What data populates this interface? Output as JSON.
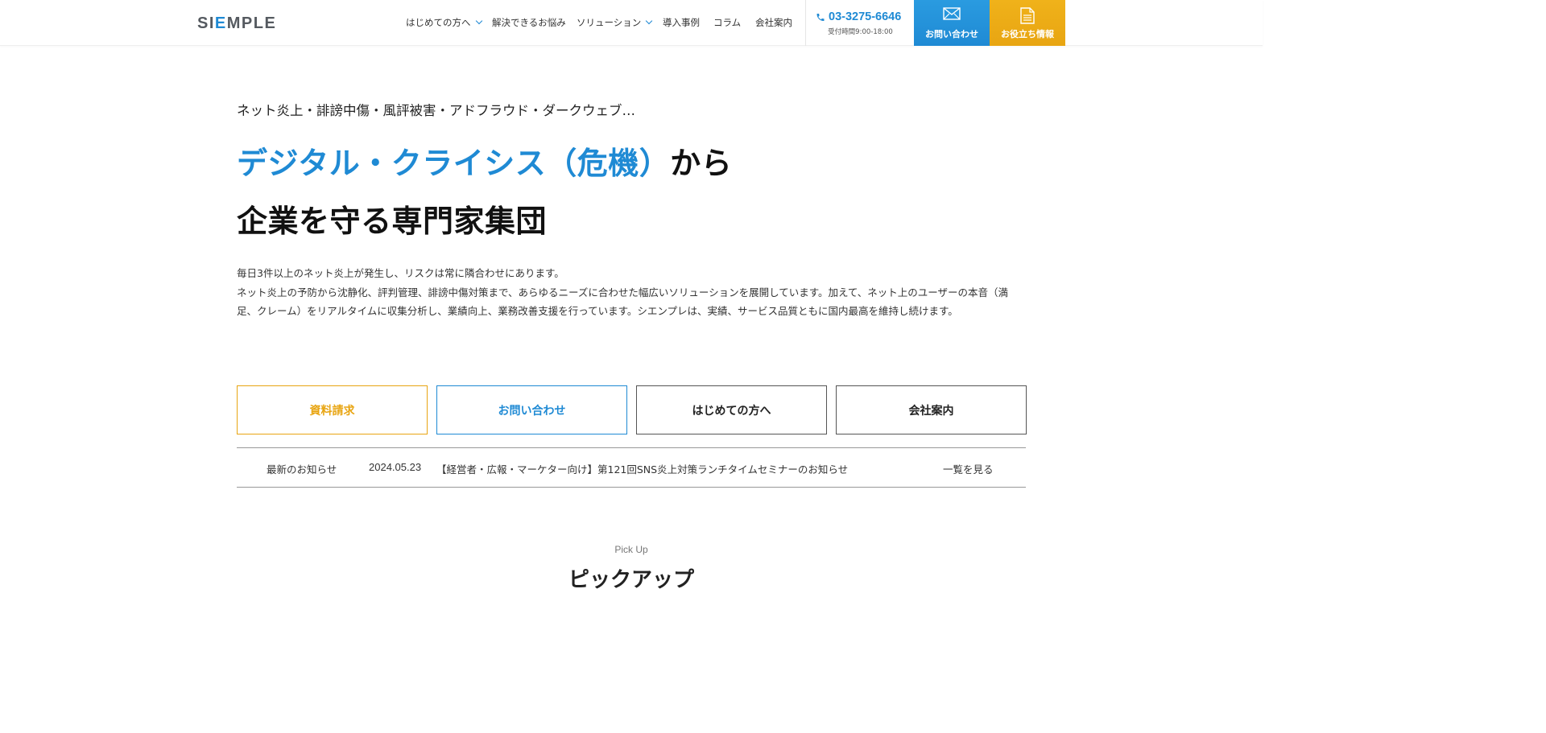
{
  "header": {
    "logo": {
      "part1": "SI",
      "part2": "E",
      "part3": "MPLE"
    },
    "nav": [
      {
        "label": "はじめての方へ",
        "has_dropdown": true
      },
      {
        "label": "解決できるお悩み",
        "has_dropdown": false
      },
      {
        "label": "ソリューション",
        "has_dropdown": true
      },
      {
        "label": "導入事例",
        "has_dropdown": false
      },
      {
        "label": "コラム",
        "has_dropdown": false
      },
      {
        "label": "会社案内",
        "has_dropdown": false
      }
    ],
    "phone": {
      "number": "03-3275-6646",
      "hours": "受付時間9:00-18:00"
    },
    "cta_contact": {
      "label": "お問い合わせ",
      "icon": "mail-icon"
    },
    "cta_info": {
      "label": "お役立ち情報",
      "icon": "document-icon"
    }
  },
  "hero": {
    "tagline": "ネット炎上・誹謗中傷・風評被害・アドフラウド・ダークウェブ…",
    "headline_accent": "デジタル・クライシス（危機）",
    "headline_rest": "から",
    "headline_line2": "企業を守る専門家集団",
    "desc_line1": "毎日3件以上のネット炎上が発生し、リスクは常に隣合わせにあります。",
    "desc_line2": "ネット炎上の予防から沈静化、評判管理、誹謗中傷対策まで、あらゆるニーズに合わせた幅広いソリューションを展開しています。加えて、ネット上のユーザーの本音（満足、クレーム）をリアルタイムに収集分析し、業績向上、業務改善支援を行っています。シエンプレは、実績、サービス品質ともに国内最高を維持し続けます。"
  },
  "buttons": {
    "request": "資料請求",
    "contact": "お問い合わせ",
    "first_time": "はじめての方へ",
    "company": "会社案内"
  },
  "news": {
    "label": "最新のお知らせ",
    "date": "2024.05.23",
    "title": "【経営者・広報・マーケター向け】第121回SNS炎上対策ランチタイムセミナーのお知らせ",
    "more": "一覧を見る"
  },
  "pickup": {
    "subtitle": "Pick Up",
    "title": "ピックアップ"
  },
  "colors": {
    "accent_blue": "#1f8ad4",
    "accent_orange": "#e8a512"
  }
}
